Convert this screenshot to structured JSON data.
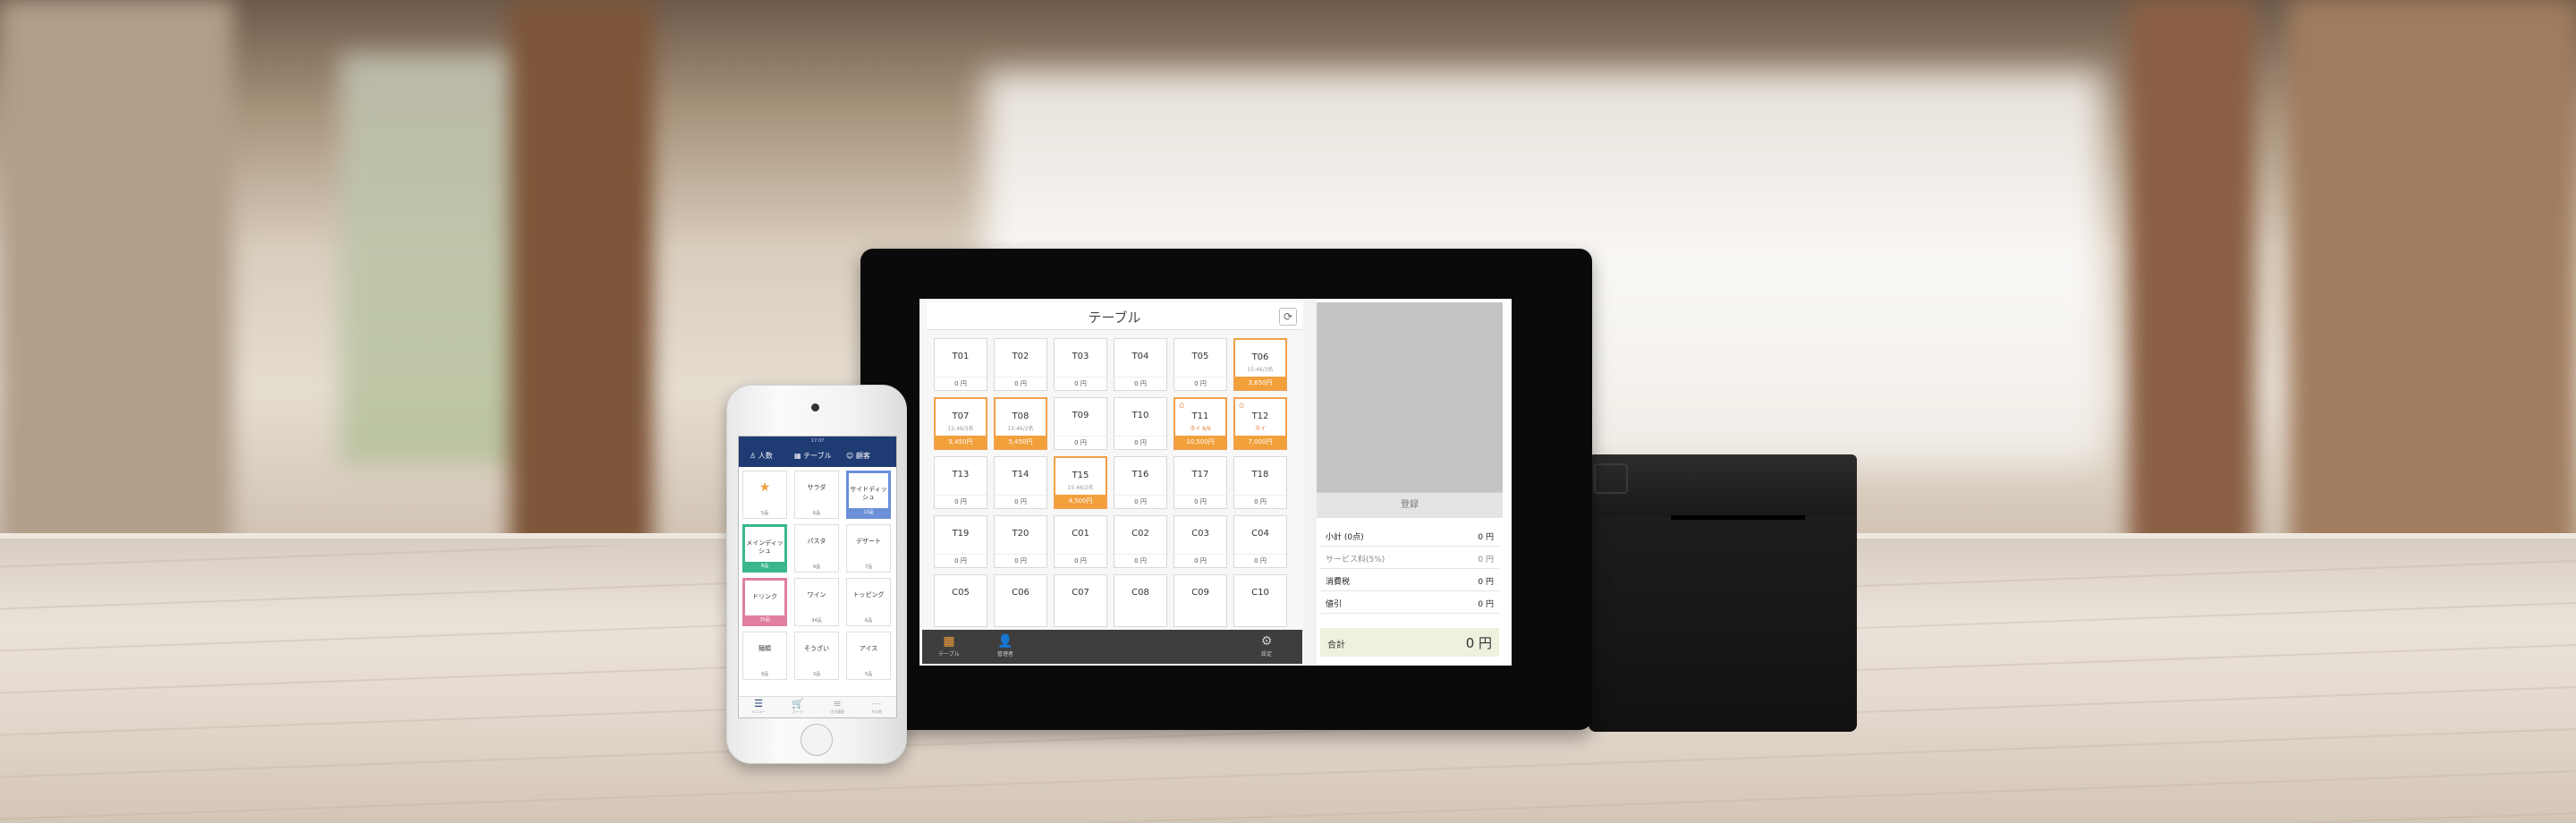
{
  "tablet": {
    "title": "テーブル",
    "refresh_icon": "⟳",
    "tables": [
      {
        "name": "T01",
        "sub": "",
        "price": "0 円",
        "active": false,
        "clock": false
      },
      {
        "name": "T02",
        "sub": "",
        "price": "0 円",
        "active": false,
        "clock": false
      },
      {
        "name": "T03",
        "sub": "",
        "price": "0 円",
        "active": false,
        "clock": false
      },
      {
        "name": "T04",
        "sub": "",
        "price": "0 円",
        "active": false,
        "clock": false
      },
      {
        "name": "T05",
        "sub": "",
        "price": "0 円",
        "active": false,
        "clock": false
      },
      {
        "name": "T06",
        "sub": "15:46/3名",
        "price": "3,650円",
        "active": true,
        "clock": false
      },
      {
        "name": "T07",
        "sub": "15:46/3名",
        "price": "5,450円",
        "active": true,
        "clock": false
      },
      {
        "name": "T08",
        "sub": "15:46/2名",
        "price": "5,450円",
        "active": true,
        "clock": false
      },
      {
        "name": "T09",
        "sub": "",
        "price": "0 円",
        "active": false,
        "clock": false
      },
      {
        "name": "T10",
        "sub": "",
        "price": "0 円",
        "active": false,
        "clock": false
      },
      {
        "name": "T11",
        "sub": "ネイ 6/6",
        "price": "10,500円",
        "active": true,
        "clock": true
      },
      {
        "name": "T12",
        "sub": "ネイ",
        "price": "7,000円",
        "active": true,
        "clock": true
      },
      {
        "name": "T13",
        "sub": "",
        "price": "0 円",
        "active": false,
        "clock": false
      },
      {
        "name": "T14",
        "sub": "",
        "price": "0 円",
        "active": false,
        "clock": false
      },
      {
        "name": "T15",
        "sub": "15:46/2名",
        "price": "4,500円",
        "active": true,
        "clock": false
      },
      {
        "name": "T16",
        "sub": "",
        "price": "0 円",
        "active": false,
        "clock": false
      },
      {
        "name": "T17",
        "sub": "",
        "price": "0 円",
        "active": false,
        "clock": false
      },
      {
        "name": "T18",
        "sub": "",
        "price": "0 円",
        "active": false,
        "clock": false
      },
      {
        "name": "T19",
        "sub": "",
        "price": "0 円",
        "active": false,
        "clock": false
      },
      {
        "name": "T20",
        "sub": "",
        "price": "0 円",
        "active": false,
        "clock": false
      },
      {
        "name": "C01",
        "sub": "",
        "price": "0 円",
        "active": false,
        "clock": false
      },
      {
        "name": "C02",
        "sub": "",
        "price": "0 円",
        "active": false,
        "clock": false
      },
      {
        "name": "C03",
        "sub": "",
        "price": "0 円",
        "active": false,
        "clock": false
      },
      {
        "name": "C04",
        "sub": "",
        "price": "0 円",
        "active": false,
        "clock": false
      },
      {
        "name": "C05",
        "sub": "",
        "price": "",
        "active": false,
        "clock": false
      },
      {
        "name": "C06",
        "sub": "",
        "price": "",
        "active": false,
        "clock": false
      },
      {
        "name": "C07",
        "sub": "",
        "price": "",
        "active": false,
        "clock": false
      },
      {
        "name": "C08",
        "sub": "",
        "price": "",
        "active": false,
        "clock": false
      },
      {
        "name": "C09",
        "sub": "",
        "price": "",
        "active": false,
        "clock": false
      },
      {
        "name": "C10",
        "sub": "",
        "price": "",
        "active": false,
        "clock": false
      }
    ],
    "nav": [
      {
        "label": "テーブル",
        "icon": "▦",
        "active": true
      },
      {
        "label": "管理者",
        "icon": "👤",
        "active": false
      },
      {
        "label": "設定",
        "icon": "⚙",
        "active": false
      }
    ],
    "register_label": "登録",
    "summary": [
      {
        "label": "小計 (0点)",
        "value": "0 円",
        "light": false
      },
      {
        "label": "サービス料(5%)",
        "value": "0 円",
        "light": true
      },
      {
        "label": "消費税",
        "value": "0 円",
        "light": false
      },
      {
        "label": "値引",
        "value": "0 円",
        "light": false
      }
    ],
    "total": {
      "label": "合計",
      "value": "0 円"
    }
  },
  "phone": {
    "status": "17:07",
    "header_tabs": [
      {
        "label": "人数",
        "icon": "person-icon"
      },
      {
        "label": "テーブル",
        "icon": "table-icon"
      },
      {
        "label": "顧客",
        "icon": "customer-icon"
      }
    ],
    "menu": [
      {
        "name": "★",
        "count": "5品",
        "style": "star"
      },
      {
        "name": "サラダ",
        "count": "6品",
        "style": ""
      },
      {
        "name": "サイドディッシュ",
        "count": "13品",
        "style": "blue"
      },
      {
        "name": "メインディッシュ",
        "count": "8品",
        "style": "green"
      },
      {
        "name": "パスタ",
        "count": "9品",
        "style": ""
      },
      {
        "name": "デザート",
        "count": "7品",
        "style": ""
      },
      {
        "name": "ドリンク",
        "count": "35品",
        "style": "pink"
      },
      {
        "name": "ワイン",
        "count": "34品",
        "style": ""
      },
      {
        "name": "トッピング",
        "count": "6品",
        "style": ""
      },
      {
        "name": "麺類",
        "count": "9品",
        "style": ""
      },
      {
        "name": "そうざい",
        "count": "3品",
        "style": ""
      },
      {
        "name": "アイス",
        "count": "5品",
        "style": ""
      }
    ],
    "tabbar": [
      {
        "label": "メニュー",
        "icon": "☰",
        "active": true
      },
      {
        "label": "カート",
        "icon": "🛒",
        "active": false
      },
      {
        "label": "注文履歴",
        "icon": "≡",
        "active": false
      },
      {
        "label": "その他",
        "icon": "⋯",
        "active": false
      }
    ]
  },
  "colors": {
    "accent": "#f2a03c",
    "phone_header": "#1f3b73",
    "blue": "#6b8fd8",
    "green": "#3ab68f",
    "pink": "#e07fa2"
  }
}
